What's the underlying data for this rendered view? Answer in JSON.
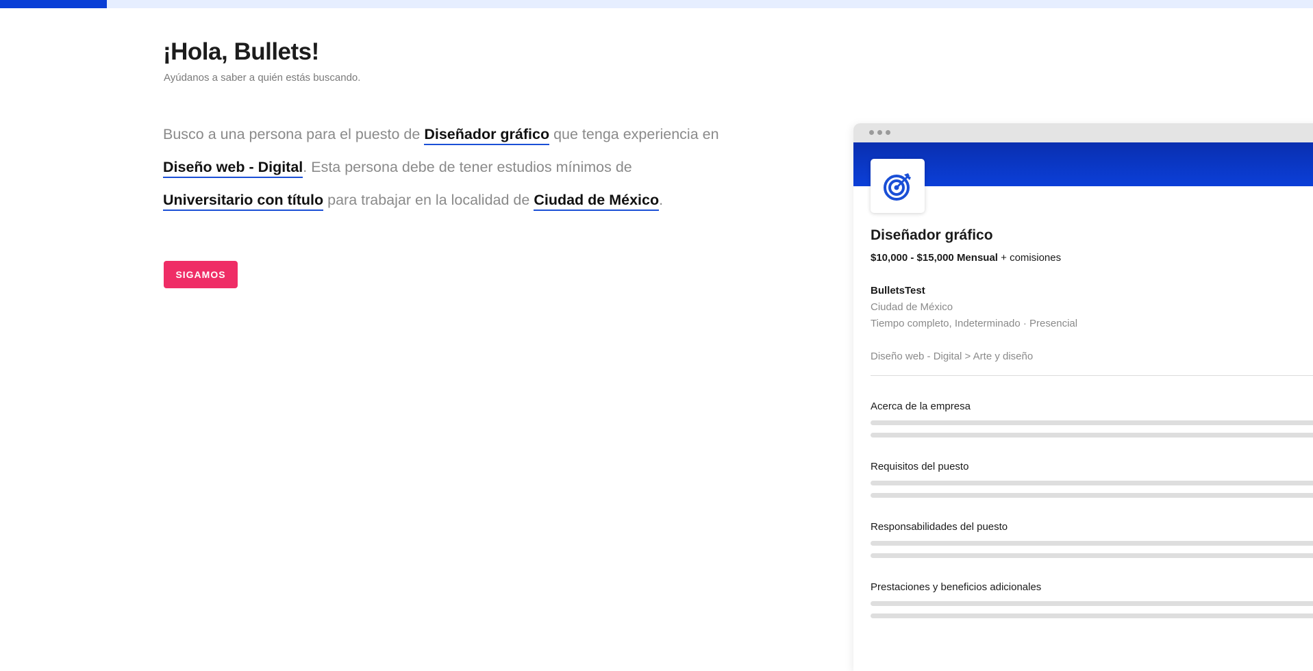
{
  "progress": {
    "fraction": 0.0814
  },
  "header": {
    "greeting": "¡Hola, Bullets!",
    "subtitle": "Ayúdanos a saber a quién estás buscando."
  },
  "sentence": {
    "part1": "Busco a una persona para el puesto de ",
    "position": "Diseñador gráfico",
    "part2": " que tenga experiencia en ",
    "area": "Diseño web - Digital",
    "part3": ". Esta persona debe de tener estudios mínimos de ",
    "education": "Universitario con título",
    "part4": " para trabajar en la localidad de ",
    "location": "Ciudad de México",
    "part5": "."
  },
  "cta": {
    "label": "SIGAMOS"
  },
  "preview": {
    "job_title": "Diseñador gráfico",
    "salary": "$10,000 - $15,000 Mensual",
    "salary_extra": " + comisiones",
    "company": "BulletsTest",
    "location": "Ciudad de México",
    "employment_type": "Tiempo completo, Indeterminado · Presencial",
    "category": "Diseño web - Digital > Arte y diseño",
    "sections": [
      {
        "title": "Acerca de la empresa"
      },
      {
        "title": "Requisitos del puesto"
      },
      {
        "title": "Responsabilidades del puesto"
      },
      {
        "title": "Prestaciones y beneficios adicionales"
      }
    ],
    "logo_icon": "target-icon"
  },
  "colors": {
    "accent_blue": "#0a3fd6",
    "cta_pink": "#ef2d66",
    "progress_track": "#e6eeff"
  }
}
